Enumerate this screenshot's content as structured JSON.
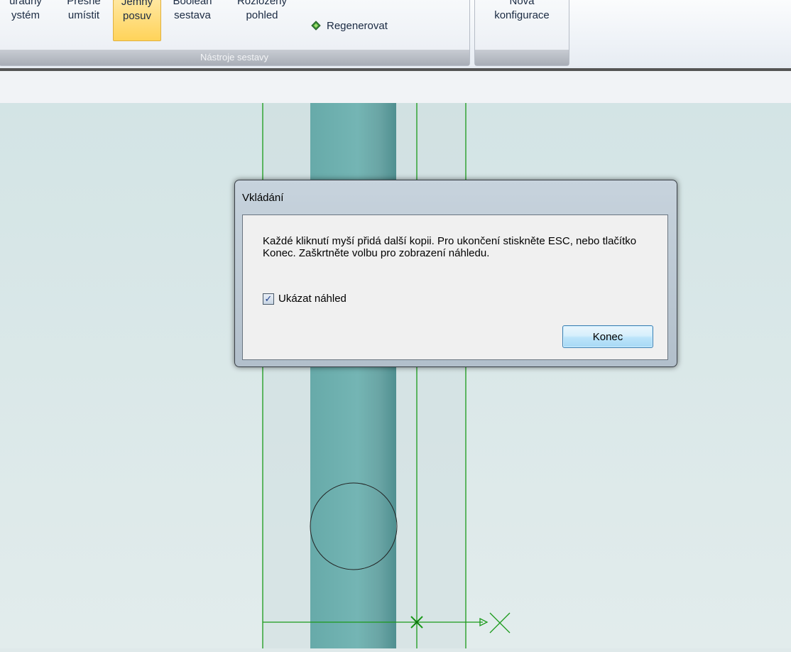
{
  "ribbon": {
    "buttons": [
      {
        "line1": "uřadný",
        "line2": "ystém"
      },
      {
        "line1": "Přesně",
        "line2": "umístit"
      },
      {
        "line1": "Jemný",
        "line2": "posuv"
      },
      {
        "line1": "Boolean",
        "line2": "sestava"
      },
      {
        "line1": "Rozložený",
        "line2": "pohled"
      }
    ],
    "regenerate_label": "Regenerovat",
    "group_assembly_caption": "Nástroje sestavy",
    "new_config": {
      "line1": "Nová",
      "line2": "konfigurace"
    }
  },
  "dialog": {
    "title": "Vkládání",
    "message": "Každé kliknutí myší přidá další kopii.  Pro ukončení stiskněte ESC, nebo tlačítko Konec.  Zaškrtněte volbu pro zobrazení náhledu.",
    "checkbox_label": "Ukázat náhled",
    "checkbox_checked": true,
    "end_button_label": "Konec"
  },
  "colors": {
    "accent_active": "#ffd35a",
    "drawing_line": "#1a9a1a",
    "shaft": "#6fb2b4"
  }
}
